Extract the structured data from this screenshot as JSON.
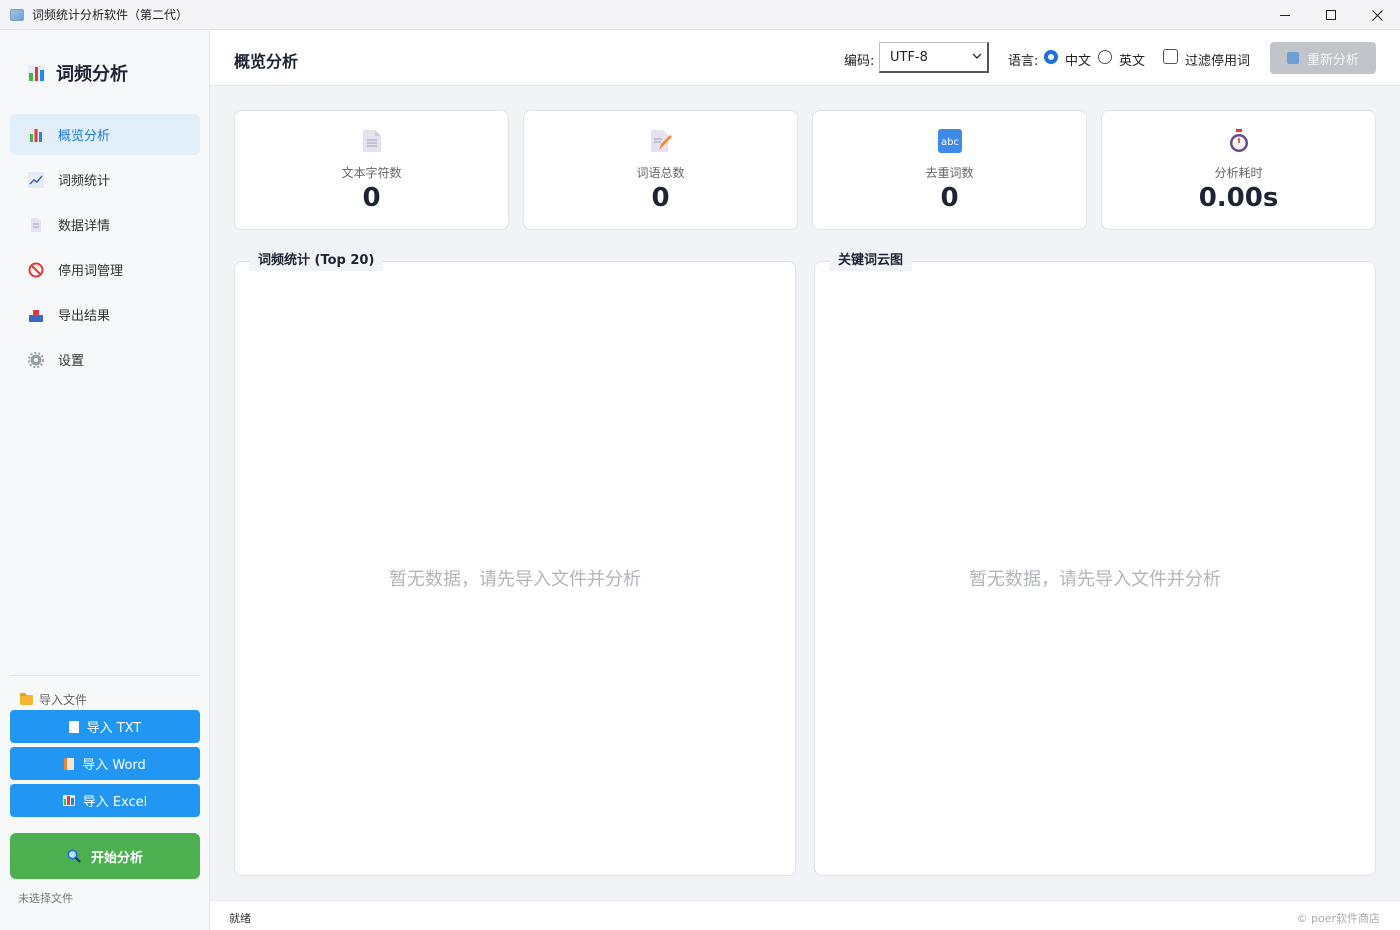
{
  "window": {
    "title": "词频统计分析软件（第二代）"
  },
  "sidebar": {
    "brand": "词频分析",
    "items": [
      {
        "label": "概览分析",
        "icon": "bar-chart-icon",
        "active": true
      },
      {
        "label": "词频统计",
        "icon": "line-chart-icon",
        "active": false
      },
      {
        "label": "数据详情",
        "icon": "document-icon",
        "active": false
      },
      {
        "label": "停用词管理",
        "icon": "prohibited-icon",
        "active": false
      },
      {
        "label": "导出结果",
        "icon": "outbox-icon",
        "active": false
      },
      {
        "label": "设置",
        "icon": "gear-icon",
        "active": false
      }
    ],
    "import_title": "导入文件",
    "import_txt": "导入 TXT",
    "import_word": "导入 Word",
    "import_excel": "导入 Excel",
    "start_label": "开始分析",
    "file_status": "未选择文件"
  },
  "header": {
    "title": "概览分析",
    "encoding_label": "编码:",
    "encoding_value": "UTF-8",
    "language_label": "语言:",
    "lang_zh": "中文",
    "lang_en": "英文",
    "lang_selected": "中文",
    "filter_label": "过滤停用词",
    "filter_checked": false,
    "reanalyze_label": "重新分析",
    "reanalyze_enabled": false
  },
  "stats": [
    {
      "label": "文本字符数",
      "value": "0",
      "icon": "document-icon"
    },
    {
      "label": "词语总数",
      "value": "0",
      "icon": "memo-icon"
    },
    {
      "label": "去重词数",
      "value": "0",
      "icon": "abc-icon"
    },
    {
      "label": "分析耗时",
      "value": "0.00s",
      "icon": "stopwatch-icon"
    }
  ],
  "panels": {
    "left_title": "词频统计 (Top 20)",
    "right_title": "关键词云图",
    "empty_text": "暂无数据，请先导入文件并分析"
  },
  "statusbar": {
    "status": "就绪",
    "copyright": "© poer软件商店"
  },
  "colors": {
    "accent": "#2196f3",
    "start": "#4caf50",
    "active_nav": "#e3eefb"
  }
}
